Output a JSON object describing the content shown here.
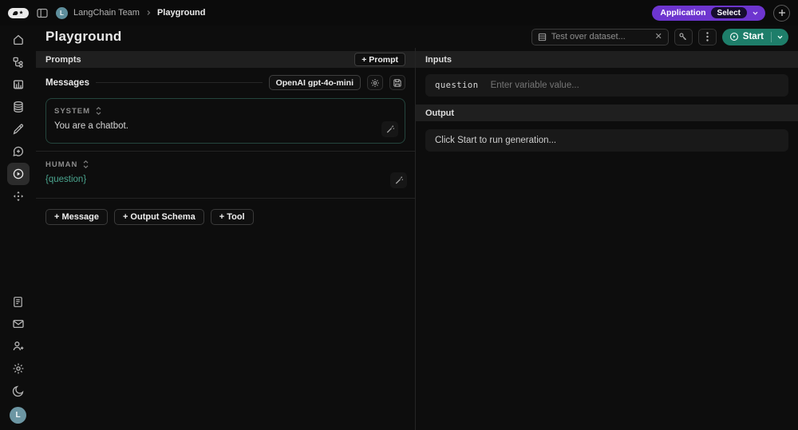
{
  "topbar": {
    "team_name": "LangChain Team",
    "page_name": "Playground",
    "team_avatar_initial": "L",
    "application_label": "Application",
    "select_label": "Select"
  },
  "header": {
    "title": "Playground",
    "dataset_placeholder": "Test over dataset...",
    "start_label": "Start"
  },
  "sidebar": {
    "user_avatar_initial": "L",
    "active_item": "playground"
  },
  "prompts_panel": {
    "header": "Prompts",
    "add_prompt_label": "+ Prompt",
    "messages_label": "Messages",
    "model_label": "OpenAI gpt-4o-mini",
    "messages": [
      {
        "role": "SYSTEM",
        "content": "You are a chatbot."
      },
      {
        "role": "HUMAN",
        "content": "{question}"
      }
    ],
    "add_message_label": "+ Message",
    "add_output_schema_label": "+ Output Schema",
    "add_tool_label": "+ Tool"
  },
  "io_panel": {
    "inputs_header": "Inputs",
    "variable_name": "question",
    "variable_placeholder": "Enter variable value...",
    "output_header": "Output",
    "output_placeholder": "Click Start to run generation..."
  },
  "colors": {
    "accent_purple": "#6d35cf",
    "accent_green": "#1e7e6a",
    "variable_teal": "#4aa58f",
    "panel_header_bg": "#1f1f1f",
    "row_bg": "#191919",
    "background": "#0d0d0d"
  }
}
